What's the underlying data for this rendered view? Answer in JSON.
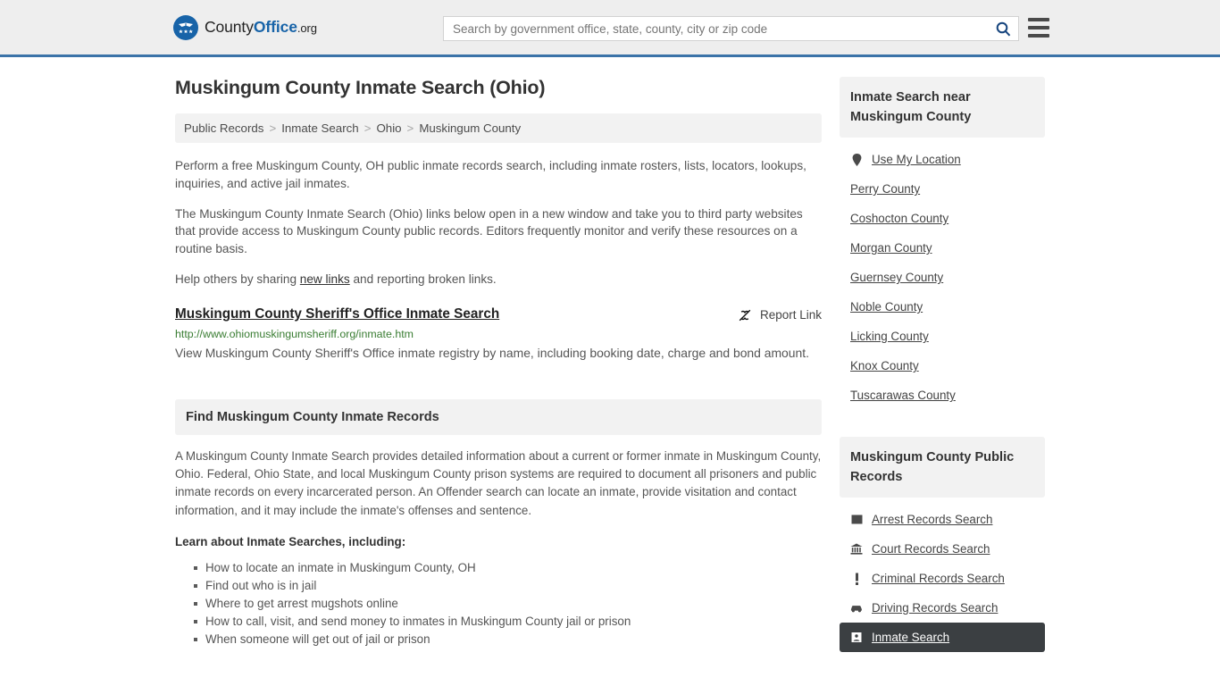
{
  "header": {
    "logo_text_1": "County",
    "logo_text_2": "Office",
    "logo_text_3": ".org",
    "logo_icon": "eagle-crest-icon",
    "search_placeholder": "Search by government office, state, county, city or zip code",
    "search_value": "",
    "search_icon": "search-icon",
    "menu_icon": "hamburger-menu-icon"
  },
  "main": {
    "title": "Muskingum County Inmate Search (Ohio)",
    "breadcrumb": [
      "Public Records",
      "Inmate Search",
      "Ohio",
      "Muskingum County"
    ],
    "breadcrumb_separator": ">",
    "intro_paragraphs": [
      "Perform a free Muskingum County, OH public inmate records search, including inmate rosters, lists, locators, lookups, inquiries, and active jail inmates.",
      "The Muskingum County Inmate Search (Ohio) links below open in a new window and take you to third party websites that provide access to Muskingum County public records. Editors frequently monitor and verify these resources on a routine basis."
    ],
    "share_prefix": "Help others by sharing ",
    "share_link": "new links",
    "share_suffix": " and reporting broken links.",
    "result": {
      "title": "Muskingum County Sheriff's Office Inmate Search",
      "url": "http://www.ohiomuskingumsheriff.org/inmate.htm",
      "description": "View Muskingum County Sheriff's Office inmate registry by name, including booking date, charge and bond amount.",
      "report_label": "Report Link",
      "report_icon": "broken-link-icon"
    },
    "section": {
      "heading": "Find Muskingum County Inmate Records",
      "paragraph": "A Muskingum County Inmate Search provides detailed information about a current or former inmate in Muskingum County, Ohio. Federal, Ohio State, and local Muskingum County prison systems are required to document all prisoners and public inmate records on every incarcerated person. An Offender search can locate an inmate, provide visitation and contact information, and it may include the inmate's offenses and sentence.",
      "lead_in": "Learn about Inmate Searches, including:",
      "bullets": [
        "How to locate an inmate in Muskingum County, OH",
        "Find out who is in jail",
        "Where to get arrest mugshots online",
        "How to call, visit, and send money to inmates in Muskingum County jail or prison",
        "When someone will get out of jail or prison"
      ]
    }
  },
  "sidebar": {
    "nearby": {
      "heading": "Inmate Search near Muskingum County",
      "items": [
        {
          "label": "Use My Location",
          "icon": "map-pin-icon"
        },
        {
          "label": "Perry County",
          "icon": ""
        },
        {
          "label": "Coshocton County",
          "icon": ""
        },
        {
          "label": "Morgan County",
          "icon": ""
        },
        {
          "label": "Guernsey County",
          "icon": ""
        },
        {
          "label": "Noble County",
          "icon": ""
        },
        {
          "label": "Licking County",
          "icon": ""
        },
        {
          "label": "Knox County",
          "icon": ""
        },
        {
          "label": "Tuscarawas County",
          "icon": ""
        }
      ]
    },
    "records": {
      "heading": "Muskingum County Public Records",
      "items": [
        {
          "label": "Arrest Records Search",
          "icon": "fingerprint-card-icon",
          "active": false
        },
        {
          "label": "Court Records Search",
          "icon": "courthouse-icon",
          "active": false
        },
        {
          "label": "Criminal Records Search",
          "icon": "exclamation-icon",
          "active": false
        },
        {
          "label": "Driving Records Search",
          "icon": "car-icon",
          "active": false
        },
        {
          "label": "Inmate Search",
          "icon": "inmate-card-icon",
          "active": true
        }
      ]
    }
  },
  "colors": {
    "brand_blue": "#1763a8",
    "header_border": "#3b73a8",
    "url_green": "#3a7d33",
    "active_row": "#3b3f42",
    "panel_gray": "#f2f2f2"
  }
}
